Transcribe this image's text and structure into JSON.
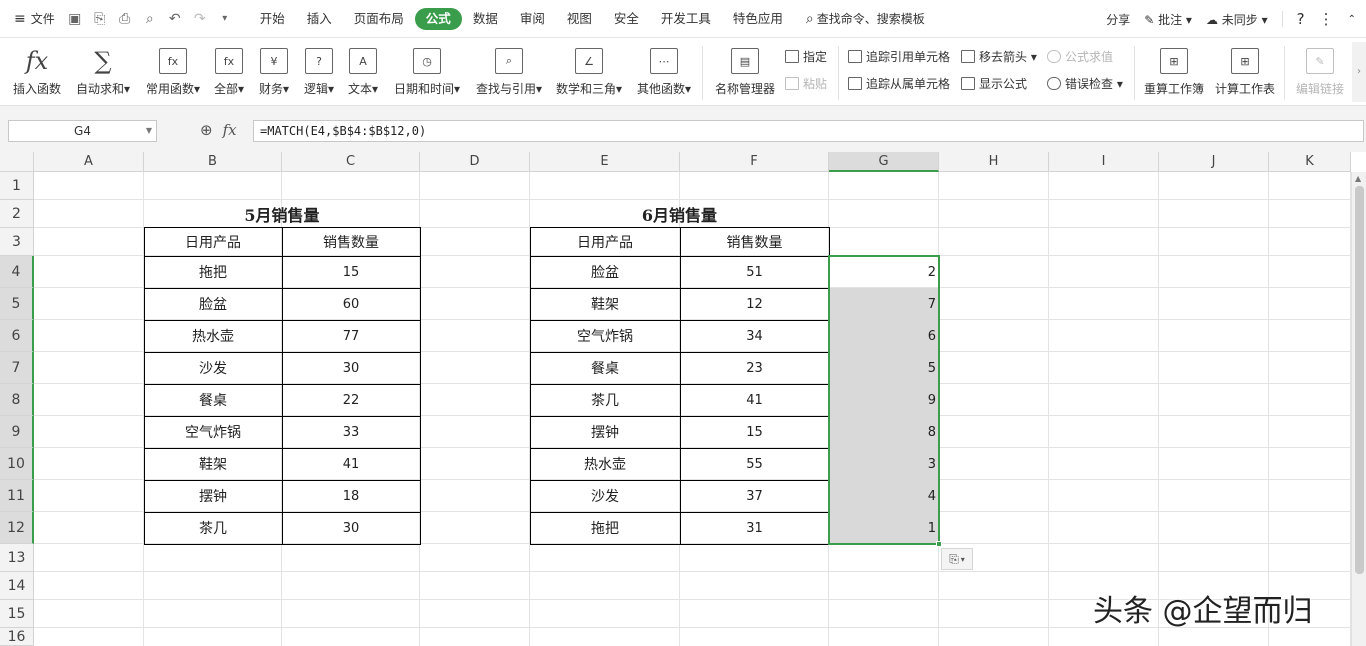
{
  "menubar": {
    "file_label": "文件",
    "tabs": [
      {
        "label": "开始"
      },
      {
        "label": "插入"
      },
      {
        "label": "页面布局"
      },
      {
        "label": "公式",
        "active": true
      },
      {
        "label": "数据"
      },
      {
        "label": "审阅"
      },
      {
        "label": "视图"
      },
      {
        "label": "安全"
      },
      {
        "label": "开发工具"
      },
      {
        "label": "特色应用"
      }
    ],
    "search_label": "查找命令、搜索模板",
    "share_label": "分享",
    "comment_label": "批注",
    "sync_label": "未同步",
    "help_icon": "?"
  },
  "ribbon": {
    "insert_function": "插入函数",
    "autosum": "自动求和",
    "common_functions": "常用函数",
    "all": "全部",
    "financial": "财务",
    "logical": "逻辑",
    "text": "文本",
    "datetime": "日期和时间",
    "lookup": "查找与引用",
    "math": "数学和三角",
    "other": "其他函数",
    "name_manager": "名称管理器",
    "define": "指定",
    "paste": "粘贴",
    "trace_precedents": "追踪引用单元格",
    "trace_dependents": "追踪从属单元格",
    "remove_arrows": "移去箭头",
    "show_formulas": "显示公式",
    "evaluate": "公式求值",
    "error_check": "错误检查",
    "recalc_book": "重算工作簿",
    "calc_sheet": "计算工作表",
    "edit_links": "编辑链接",
    "icon_labels": {
      "fx": "fx",
      "sum": "∑",
      "common": "fx",
      "all": "fx",
      "financial": "¥",
      "logical": "?",
      "text": "A"
    }
  },
  "formula_bar": {
    "name_box": "G4",
    "fx_label": "fx",
    "formula": "=MATCH(E4,$B$4:$B$12,0)"
  },
  "grid": {
    "columns": [
      "A",
      "B",
      "C",
      "D",
      "E",
      "F",
      "G",
      "H",
      "I",
      "J",
      "K"
    ],
    "selected_column": "G",
    "rows": [
      "1",
      "2",
      "3",
      "4",
      "5",
      "6",
      "7",
      "8",
      "9",
      "10",
      "11",
      "12",
      "13",
      "14",
      "15",
      "16"
    ],
    "may_table": {
      "title": "5月销售量",
      "headers": [
        "日用产品",
        "销售数量"
      ],
      "rows": [
        {
          "product": "拖把",
          "qty": "15"
        },
        {
          "product": "脸盆",
          "qty": "60"
        },
        {
          "product": "热水壶",
          "qty": "77"
        },
        {
          "product": "沙发",
          "qty": "30"
        },
        {
          "product": "餐桌",
          "qty": "22"
        },
        {
          "product": "空气炸锅",
          "qty": "33"
        },
        {
          "product": "鞋架",
          "qty": "41"
        },
        {
          "product": "摆钟",
          "qty": "18"
        },
        {
          "product": "茶几",
          "qty": "30"
        }
      ]
    },
    "june_table": {
      "title": "6月销售量",
      "headers": [
        "日用产品",
        "销售数量"
      ],
      "rows": [
        {
          "product": "脸盆",
          "qty": "51"
        },
        {
          "product": "鞋架",
          "qty": "12"
        },
        {
          "product": "空气炸锅",
          "qty": "34"
        },
        {
          "product": "餐桌",
          "qty": "23"
        },
        {
          "product": "茶几",
          "qty": "41"
        },
        {
          "product": "摆钟",
          "qty": "15"
        },
        {
          "product": "热水壶",
          "qty": "55"
        },
        {
          "product": "沙发",
          "qty": "37"
        },
        {
          "product": "拖把",
          "qty": "31"
        }
      ]
    },
    "match_results": [
      "2",
      "7",
      "6",
      "5",
      "9",
      "8",
      "3",
      "4",
      "1"
    ]
  },
  "watermark": "头条 @企望而归",
  "colors": {
    "accent": "#3a9d4b",
    "selection_fill": "#d9d9d9"
  }
}
